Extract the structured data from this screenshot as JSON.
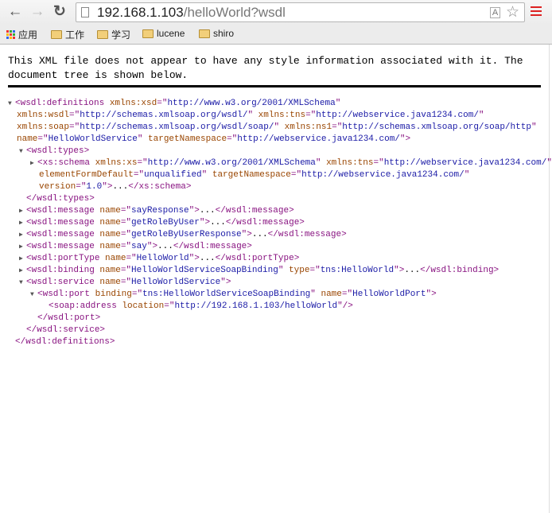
{
  "browser": {
    "url_host": "192.168.1.103",
    "url_path": "/helloWorld?wsdl",
    "icons": [
      "back-icon",
      "forward-icon",
      "reload-icon",
      "page-icon",
      "translate-icon",
      "star-icon",
      "menu-icon"
    ],
    "bookmarks": [
      {
        "label": "应用",
        "icon": "apps-icon"
      },
      {
        "label": "工作",
        "icon": "folder-icon"
      },
      {
        "label": "学习",
        "icon": "folder-icon"
      },
      {
        "label": "lucene",
        "icon": "folder-icon"
      },
      {
        "label": "shiro",
        "icon": "folder-icon"
      }
    ]
  },
  "notice": "This XML file does not appear to have any style information associated with it. The document tree is shown below.",
  "colors": {
    "tag": "#881280",
    "attr_name": "#994500",
    "attr_value": "#1a1aa6",
    "menu": "#dd2222"
  },
  "xml": {
    "lines": [
      {
        "depth": 0,
        "toggle": "expanded",
        "segs": [
          [
            "t",
            "<wsdl:definitions "
          ],
          [
            "a",
            "xmlns:xsd"
          ],
          [
            "t",
            "=\""
          ],
          [
            "v",
            "http://www.w3.org/2001/XMLSchema"
          ],
          [
            "t",
            "\""
          ]
        ]
      },
      {
        "depth": 0,
        "cont": true,
        "segs": [
          [
            "a",
            "xmlns:wsdl"
          ],
          [
            "t",
            "=\""
          ],
          [
            "v",
            "http://schemas.xmlsoap.org/wsdl/"
          ],
          [
            "t",
            "\" "
          ],
          [
            "a",
            "xmlns:tns"
          ],
          [
            "t",
            "=\""
          ],
          [
            "v",
            "http://webservice.java1234.com/"
          ],
          [
            "t",
            "\""
          ]
        ]
      },
      {
        "depth": 0,
        "cont": true,
        "segs": [
          [
            "a",
            "xmlns:soap"
          ],
          [
            "t",
            "=\""
          ],
          [
            "v",
            "http://schemas.xmlsoap.org/wsdl/soap/"
          ],
          [
            "t",
            "\" "
          ],
          [
            "a",
            "xmlns:ns1"
          ],
          [
            "t",
            "=\""
          ],
          [
            "v",
            "http://schemas.xmlsoap.org/soap/http"
          ],
          [
            "t",
            "\""
          ]
        ]
      },
      {
        "depth": 0,
        "cont": true,
        "segs": [
          [
            "a",
            "name"
          ],
          [
            "t",
            "=\""
          ],
          [
            "v",
            "HelloWorldService"
          ],
          [
            "t",
            "\" "
          ],
          [
            "a",
            "targetNamespace"
          ],
          [
            "t",
            "=\""
          ],
          [
            "v",
            "http://webservice.java1234.com/"
          ],
          [
            "t",
            "\">"
          ]
        ]
      },
      {
        "depth": 1,
        "toggle": "expanded",
        "segs": [
          [
            "t",
            "<wsdl:types>"
          ]
        ]
      },
      {
        "depth": 2,
        "toggle": "collapsed",
        "segs": [
          [
            "t",
            "<xs:schema "
          ],
          [
            "a",
            "xmlns:xs"
          ],
          [
            "t",
            "=\""
          ],
          [
            "v",
            "http://www.w3.org/2001/XMLSchema"
          ],
          [
            "t",
            "\" "
          ],
          [
            "a",
            "xmlns:tns"
          ],
          [
            "t",
            "=\""
          ],
          [
            "v",
            "http://webservice.java1234.com/"
          ],
          [
            "t",
            "\""
          ]
        ]
      },
      {
        "depth": 2,
        "cont": true,
        "segs": [
          [
            "a",
            "elementFormDefault"
          ],
          [
            "t",
            "=\""
          ],
          [
            "v",
            "unqualified"
          ],
          [
            "t",
            "\" "
          ],
          [
            "a",
            "targetNamespace"
          ],
          [
            "t",
            "=\""
          ],
          [
            "v",
            "http://webservice.java1234.com/"
          ],
          [
            "t",
            "\""
          ]
        ]
      },
      {
        "depth": 2,
        "cont": true,
        "segs": [
          [
            "a",
            "version"
          ],
          [
            "t",
            "=\""
          ],
          [
            "v",
            "1.0"
          ],
          [
            "t",
            "\">"
          ],
          [
            "x",
            "..."
          ],
          [
            "t",
            "</xs:schema>"
          ]
        ]
      },
      {
        "depth": 1,
        "segs": [
          [
            "t",
            "</wsdl:types>"
          ]
        ]
      },
      {
        "depth": 1,
        "toggle": "collapsed",
        "segs": [
          [
            "t",
            "<wsdl:message "
          ],
          [
            "a",
            "name"
          ],
          [
            "t",
            "=\""
          ],
          [
            "v",
            "sayResponse"
          ],
          [
            "t",
            "\">"
          ],
          [
            "x",
            "..."
          ],
          [
            "t",
            "</wsdl:message>"
          ]
        ]
      },
      {
        "depth": 1,
        "toggle": "collapsed",
        "segs": [
          [
            "t",
            "<wsdl:message "
          ],
          [
            "a",
            "name"
          ],
          [
            "t",
            "=\""
          ],
          [
            "v",
            "getRoleByUser"
          ],
          [
            "t",
            "\">"
          ],
          [
            "x",
            "..."
          ],
          [
            "t",
            "</wsdl:message>"
          ]
        ]
      },
      {
        "depth": 1,
        "toggle": "collapsed",
        "segs": [
          [
            "t",
            "<wsdl:message "
          ],
          [
            "a",
            "name"
          ],
          [
            "t",
            "=\""
          ],
          [
            "v",
            "getRoleByUserResponse"
          ],
          [
            "t",
            "\">"
          ],
          [
            "x",
            "..."
          ],
          [
            "t",
            "</wsdl:message>"
          ]
        ]
      },
      {
        "depth": 1,
        "toggle": "collapsed",
        "segs": [
          [
            "t",
            "<wsdl:message "
          ],
          [
            "a",
            "name"
          ],
          [
            "t",
            "=\""
          ],
          [
            "v",
            "say"
          ],
          [
            "t",
            "\">"
          ],
          [
            "x",
            "..."
          ],
          [
            "t",
            "</wsdl:message>"
          ]
        ]
      },
      {
        "depth": 1,
        "toggle": "collapsed",
        "segs": [
          [
            "t",
            "<wsdl:portType "
          ],
          [
            "a",
            "name"
          ],
          [
            "t",
            "=\""
          ],
          [
            "v",
            "HelloWorld"
          ],
          [
            "t",
            "\">"
          ],
          [
            "x",
            "..."
          ],
          [
            "t",
            "</wsdl:portType>"
          ]
        ]
      },
      {
        "depth": 1,
        "toggle": "collapsed",
        "segs": [
          [
            "t",
            "<wsdl:binding "
          ],
          [
            "a",
            "name"
          ],
          [
            "t",
            "=\""
          ],
          [
            "v",
            "HelloWorldServiceSoapBinding"
          ],
          [
            "t",
            "\" "
          ],
          [
            "a",
            "type"
          ],
          [
            "t",
            "=\""
          ],
          [
            "v",
            "tns:HelloWorld"
          ],
          [
            "t",
            "\">"
          ],
          [
            "x",
            "..."
          ],
          [
            "t",
            "</wsdl:binding>"
          ]
        ]
      },
      {
        "depth": 1,
        "toggle": "expanded",
        "segs": [
          [
            "t",
            "<wsdl:service "
          ],
          [
            "a",
            "name"
          ],
          [
            "t",
            "=\""
          ],
          [
            "v",
            "HelloWorldService"
          ],
          [
            "t",
            "\">"
          ]
        ]
      },
      {
        "depth": 2,
        "toggle": "expanded",
        "segs": [
          [
            "t",
            "<wsdl:port "
          ],
          [
            "a",
            "binding"
          ],
          [
            "t",
            "=\""
          ],
          [
            "v",
            "tns:HelloWorldServiceSoapBinding"
          ],
          [
            "t",
            "\" "
          ],
          [
            "a",
            "name"
          ],
          [
            "t",
            "=\""
          ],
          [
            "v",
            "HelloWorldPort"
          ],
          [
            "t",
            "\">"
          ]
        ]
      },
      {
        "depth": 3,
        "segs": [
          [
            "t",
            "<soap:address "
          ],
          [
            "a",
            "location"
          ],
          [
            "t",
            "=\""
          ],
          [
            "v",
            "http://192.168.1.103/helloWorld"
          ],
          [
            "t",
            "\"/>"
          ]
        ]
      },
      {
        "depth": 2,
        "segs": [
          [
            "t",
            "</wsdl:port>"
          ]
        ]
      },
      {
        "depth": 1,
        "segs": [
          [
            "t",
            "</wsdl:service>"
          ]
        ]
      },
      {
        "depth": 0,
        "segs": [
          [
            "t",
            "</wsdl:definitions>"
          ]
        ]
      }
    ]
  }
}
